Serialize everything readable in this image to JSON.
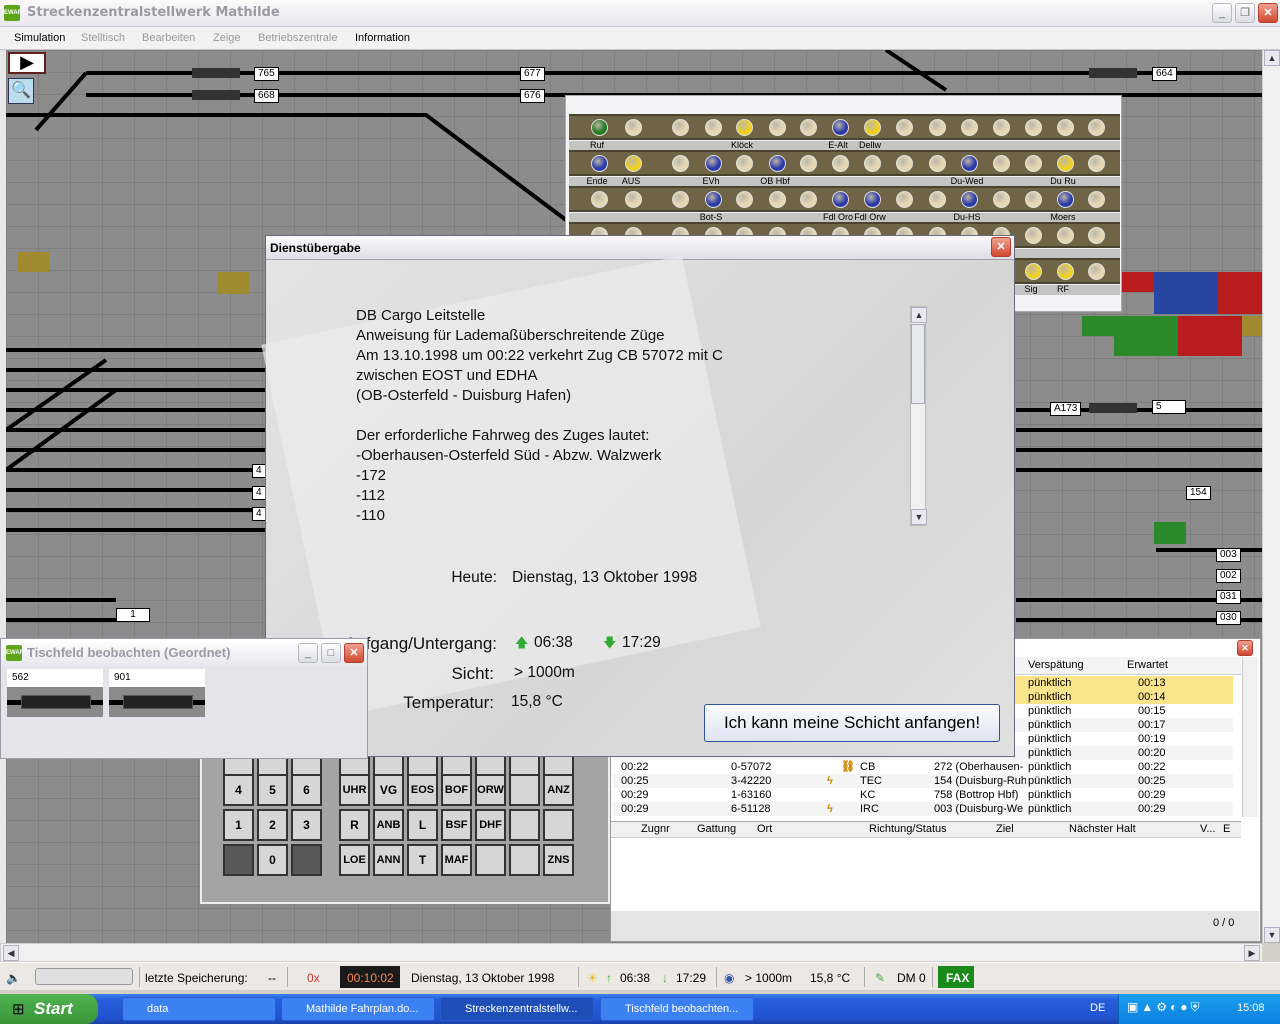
{
  "app": {
    "title": "Streckenzentralstellwerk Mathilde",
    "icon": "EWAF"
  },
  "menu": [
    "Simulation",
    "Stelltisch",
    "Bearbeiten",
    "Zeige",
    "Betriebszentrale",
    "Information"
  ],
  "menu_enabled": [
    true,
    false,
    false,
    false,
    false,
    true
  ],
  "track_labels": [
    "765",
    "668",
    "677",
    "676",
    "664",
    "A173",
    "5",
    "154",
    "003",
    "002",
    "031",
    "030",
    "1",
    "4",
    "4",
    "4",
    "676"
  ],
  "signal_panel": {
    "rows": [
      {
        "lamps": [
          "g",
          "b",
          "b",
          "b",
          "y",
          "b",
          "b",
          "u",
          "y",
          "b",
          "b",
          "b",
          "b",
          "b",
          "b",
          "b"
        ],
        "labels": [
          [
            "Ruf",
            0
          ],
          [
            "Klöck",
            4
          ],
          [
            "E-Alt",
            7
          ],
          [
            "Dellw",
            8
          ]
        ]
      },
      {
        "lamps": [
          "u",
          "y",
          "b",
          "u",
          "b",
          "u",
          "b",
          "b",
          "b",
          "b",
          "b",
          "u",
          "b",
          "b",
          "y",
          "b"
        ],
        "labels": [
          [
            "Ende",
            0
          ],
          [
            "AUS",
            1
          ],
          [
            "EVh",
            3
          ],
          [
            "OB Hbf",
            5
          ],
          [
            "Du-Wed",
            11
          ],
          [
            "Du Ru",
            14
          ]
        ]
      },
      {
        "lamps": [
          "b",
          "b",
          "b",
          "u",
          "b",
          "b",
          "b",
          "u",
          "u",
          "b",
          "b",
          "u",
          "b",
          "b",
          "u",
          "b"
        ],
        "labels": [
          [
            "Bot-S",
            3
          ],
          [
            "Fdl Oro",
            7
          ],
          [
            "Fdl Orw",
            8
          ],
          [
            "Du-HS",
            11
          ],
          [
            "Moers",
            14
          ]
        ]
      },
      {
        "lamps": [
          "b",
          "b",
          "b",
          "b",
          "b",
          "b",
          "b",
          "b",
          "b",
          "b",
          "b",
          "b",
          "b",
          "b",
          "b",
          "b"
        ],
        "labels": []
      },
      {
        "lamps": [
          "b",
          "b",
          "b",
          "b",
          "b",
          "b",
          "b",
          "b",
          "b",
          "b",
          "b",
          "b",
          "b",
          "y",
          "y",
          "b"
        ],
        "labels": [
          [
            "Sig",
            13
          ],
          [
            "RF",
            14
          ]
        ]
      }
    ],
    "colors": {
      "g": "#1e7a1e",
      "b": "#e6d8b4",
      "y": "#f0d020",
      "u": "#2a3aa8"
    }
  },
  "dialog": {
    "title": "Dienstübergabe",
    "message": "DB Cargo Leitstelle\nAnweisung für Lademaßüberschreitende Züge\nAm 13.10.1998 um 00:22 verkehrt Zug CB 57072 mit C\nzwischen EOST und EDHA\n(OB-Osterfeld - Duisburg Hafen)\n\nDer erforderliche Fahrweg des Zuges lautet:\n-Oberhausen-Osterfeld Süd - Abzw. Walzwerk\n-172\n-112\n-110",
    "today_label": "Heute:",
    "today_value": "Dienstag, 13 Oktober 1998",
    "sun_label": "Aufgang/Untergang:",
    "sunrise": "06:38",
    "sunset": "17:29",
    "visibility_label": "Sicht:",
    "visibility": "> 1000m",
    "temperature_label": "Temperatur:",
    "temperature": "15,8 °C",
    "start_button": "Ich kann meine Schicht anfangen!"
  },
  "tischfeld": {
    "title": "Tischfeld beobachten (Geordnet)",
    "fields": [
      "562",
      "901"
    ]
  },
  "keypad": {
    "numeric": [
      [
        "",
        "",
        ""
      ],
      [
        "4",
        "5",
        "6"
      ],
      [
        "1",
        "2",
        "3"
      ],
      [
        "",
        "0",
        ""
      ]
    ],
    "commands": [
      [
        "",
        "",
        "",
        "",
        "",
        "",
        ""
      ],
      [
        "UHR",
        "VG",
        "EOS",
        "BOF",
        "ORW",
        "",
        "ANZ"
      ],
      [
        "R",
        "ANB",
        "L",
        "BSF",
        "DHF",
        "",
        ""
      ],
      [
        "LOE",
        "ANN",
        "T",
        "MAF",
        "",
        "",
        "ZNS"
      ]
    ]
  },
  "timetable": {
    "columns": [
      "Verspätung",
      "Erwartet"
    ],
    "rows": [
      {
        "time": "",
        "zug": "",
        "gattung": "",
        "richtung": "",
        "delay": "pünktlich",
        "expected": "00:13",
        "highlight": true
      },
      {
        "time": "",
        "zug": "",
        "gattung": "",
        "richtung": "",
        "delay": "pünktlich",
        "expected": "00:14",
        "highlight": true
      },
      {
        "time": "",
        "zug": "",
        "gattung": "",
        "richtung": "",
        "delay": "pünktlich",
        "expected": "00:15"
      },
      {
        "time": "",
        "zug": "",
        "gattung": "",
        "richtung": "",
        "delay": "pünktlich",
        "expected": "00:17"
      },
      {
        "time": "",
        "zug": "",
        "gattung": "",
        "richtung": "",
        "delay": "pünktlich",
        "expected": "00:19"
      },
      {
        "time": "",
        "zug": "",
        "gattung": "",
        "richtung": "",
        "delay": "pünktlich",
        "expected": "00:20"
      },
      {
        "time": "00:22",
        "zug": "0-57072",
        "icon": "diesel",
        "gattung": "CB",
        "richtung": "272 (Oberhausen-",
        "delay": "pünktlich",
        "expected": "00:22"
      },
      {
        "time": "00:25",
        "zug": "3-42220",
        "icon": "electric",
        "gattung": "TEC",
        "richtung": "154 (Duisburg-Ruh",
        "delay": "pünktlich",
        "expected": "00:25"
      },
      {
        "time": "00:29",
        "zug": "1-63160",
        "icon": "",
        "gattung": "KC",
        "richtung": "758 (Bottrop Hbf)",
        "delay": "pünktlich",
        "expected": "00:29"
      },
      {
        "time": "00:29",
        "zug": "6-51128",
        "icon": "electric",
        "gattung": "IRC",
        "richtung": "003 (Duisburg-We",
        "delay": "pünktlich",
        "expected": "00:29"
      }
    ],
    "lower_columns": [
      "Zugnr",
      "Gattung",
      "Ort",
      "Richtung/Status",
      "Ziel",
      "Nächster Halt",
      "V...",
      "E"
    ],
    "count": "0 / 0"
  },
  "status": {
    "save_label": "letzte Speicherung:",
    "save_value": "--",
    "speed": "0x",
    "clock": "00:10:02",
    "date": "Dienstag, 13 Oktober 1998",
    "sunrise": "06:38",
    "sunset": "17:29",
    "visibility": "> 1000m",
    "temperature": "15,8 °C",
    "money": "DM 0",
    "fax": "FAX"
  },
  "taskbar": {
    "start": "Start",
    "tasks": [
      "data",
      "Mathilde Fahrplan.do...",
      "Streckenzentralstellw...",
      "Tischfeld beobachten..."
    ],
    "lang": "DE",
    "time": "15:08"
  }
}
